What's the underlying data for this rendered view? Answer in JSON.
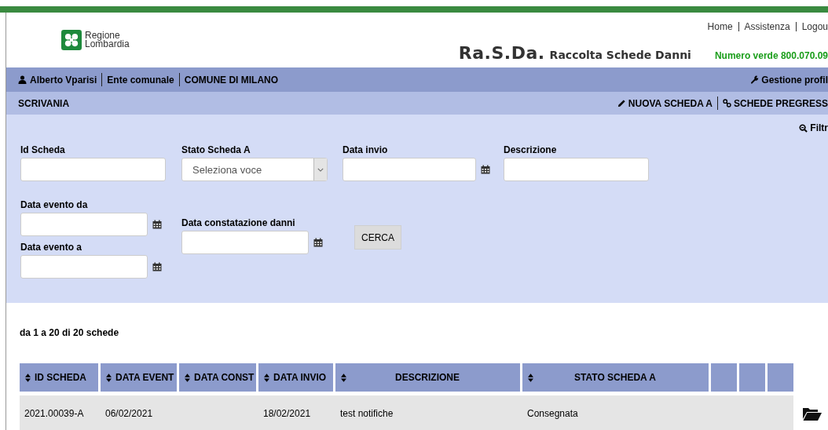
{
  "header": {
    "logo_lines": [
      "Regione",
      "Lombardia"
    ],
    "top_links": [
      "Home",
      "Assistenza",
      "Logou"
    ],
    "app_title": "Ra.S.Da.",
    "app_subtitle": "Raccolta Schede Danni",
    "toll_free": "Numero verde 800.070.09"
  },
  "user_bar": {
    "items": [
      "Alberto Vparisi",
      "Ente comunale",
      "COMUNE DI MILANO"
    ],
    "profile_link": "Gestione profil"
  },
  "nav_bar": {
    "title": "SCRIVANIA",
    "links": [
      {
        "label": "NUOVA SCHEDA A",
        "kind": "pencil"
      },
      {
        "label": "SCHEDE PREGRESS",
        "kind": "link"
      }
    ]
  },
  "filters": {
    "toggle": "Filtr",
    "row1": [
      {
        "label": "Id Scheda",
        "kind": "text"
      },
      {
        "label": "Stato Scheda A",
        "kind": "select",
        "placeholder": "Seleziona voce"
      },
      {
        "label": "Data invio",
        "kind": "date"
      },
      {
        "label": "Descrizione",
        "kind": "text"
      }
    ],
    "event_dates": [
      {
        "label": "Data evento da",
        "kind": "date"
      },
      {
        "label": "Data evento a",
        "kind": "date"
      }
    ],
    "damage_date": {
      "label": "Data constatazione danni",
      "kind": "date"
    },
    "search_button": "CERCA"
  },
  "results": {
    "summary": "da 1 a 20 di 20 schede",
    "columns": [
      {
        "label": "ID SCHEDA",
        "sortable": true
      },
      {
        "label": "DATA EVENT",
        "sortable": true
      },
      {
        "label": "DATA CONST",
        "sortable": true
      },
      {
        "label": "DATA INVIO",
        "sortable": true
      },
      {
        "label": "DESCRIZIONE",
        "sortable": true
      },
      {
        "label": "STATO SCHEDA A",
        "sortable": true
      },
      {
        "sortable": false
      },
      {
        "sortable": false
      },
      {
        "sortable": false
      }
    ],
    "rows": [
      {
        "cells": [
          "2021.00039-A",
          "06/02/2021",
          "",
          "18/02/2021",
          "test notifiche",
          "Consegnata"
        ]
      }
    ]
  }
}
